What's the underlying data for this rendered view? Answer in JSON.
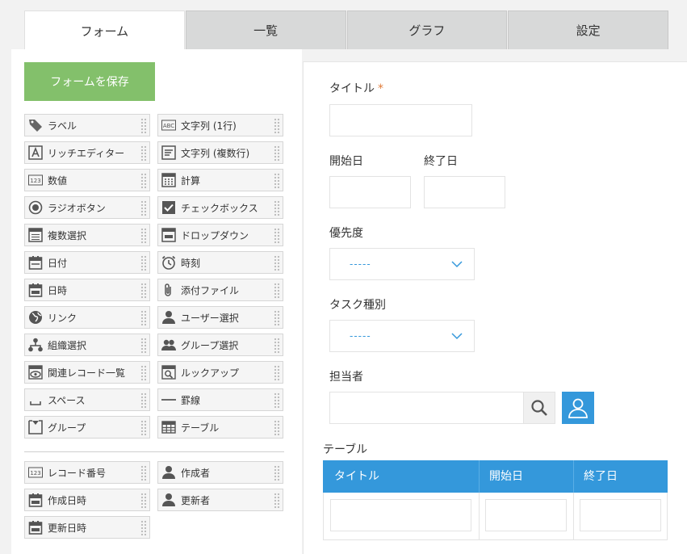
{
  "tabs": [
    "フォーム",
    "一覧",
    "グラフ",
    "設定"
  ],
  "save_button": "フォームを保存",
  "palette": {
    "left": [
      {
        "label": "ラベル",
        "icon": "tag-icon"
      },
      {
        "label": "リッチエディター",
        "icon": "rich-editor-icon"
      },
      {
        "label": "数値",
        "icon": "number-icon"
      },
      {
        "label": "ラジオボタン",
        "icon": "radio-icon"
      },
      {
        "label": "複数選択",
        "icon": "multi-select-icon"
      },
      {
        "label": "日付",
        "icon": "calendar-icon"
      },
      {
        "label": "日時",
        "icon": "datetime-icon"
      },
      {
        "label": "リンク",
        "icon": "globe-icon"
      },
      {
        "label": "組織選択",
        "icon": "org-icon"
      },
      {
        "label": "関連レコード一覧",
        "icon": "related-records-icon"
      },
      {
        "label": "スペース",
        "icon": "space-icon"
      },
      {
        "label": "グループ",
        "icon": "group-field-icon"
      }
    ],
    "right": [
      {
        "label": "文字列 (1行)",
        "icon": "abc-icon"
      },
      {
        "label": "文字列 (複数行)",
        "icon": "multiline-text-icon"
      },
      {
        "label": "計算",
        "icon": "calculator-icon"
      },
      {
        "label": "チェックボックス",
        "icon": "checkbox-icon"
      },
      {
        "label": "ドロップダウン",
        "icon": "dropdown-icon"
      },
      {
        "label": "時刻",
        "icon": "clock-icon"
      },
      {
        "label": "添付ファイル",
        "icon": "paperclip-icon"
      },
      {
        "label": "ユーザー選択",
        "icon": "user-icon"
      },
      {
        "label": "グループ選択",
        "icon": "users-icon"
      },
      {
        "label": "ルックアップ",
        "icon": "lookup-icon"
      },
      {
        "label": "罫線",
        "icon": "line-icon"
      },
      {
        "label": "テーブル",
        "icon": "table-icon"
      }
    ],
    "system_left": [
      {
        "label": "レコード番号",
        "icon": "number-icon"
      },
      {
        "label": "作成日時",
        "icon": "calendar-icon"
      },
      {
        "label": "更新日時",
        "icon": "calendar-icon"
      }
    ],
    "system_right": [
      {
        "label": "作成者",
        "icon": "user-icon"
      },
      {
        "label": "更新者",
        "icon": "user-icon"
      }
    ]
  },
  "form": {
    "title_label": "タイトル",
    "required_mark": "*",
    "start_label": "開始日",
    "end_label": "終了日",
    "priority_label": "優先度",
    "priority_placeholder": "-----",
    "task_type_label": "タスク種別",
    "task_type_placeholder": "-----",
    "assignee_label": "担当者",
    "table_label": "テーブル",
    "table_columns": [
      "タイトル",
      "開始日",
      "終了日"
    ]
  },
  "colors": {
    "accent": "#3498db",
    "save": "#83c06b",
    "required": "#e07b39"
  }
}
